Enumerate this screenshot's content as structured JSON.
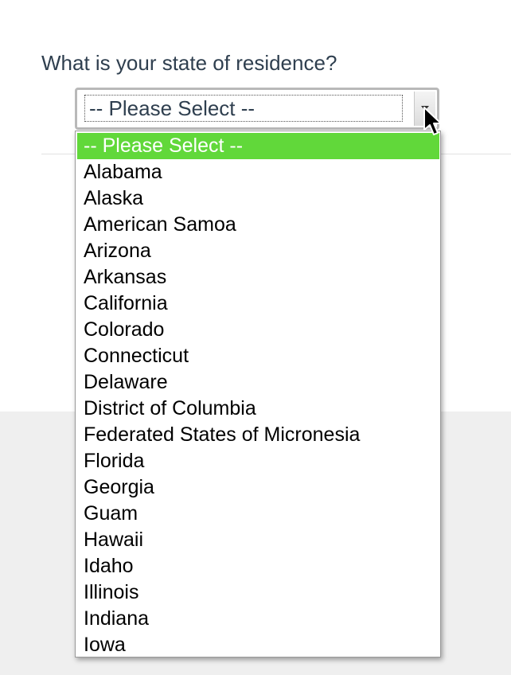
{
  "question": "What is your state of residence?",
  "select": {
    "value": "-- Please Select --"
  },
  "dropdown": {
    "options": [
      "-- Please Select --",
      "Alabama",
      "Alaska",
      "American Samoa",
      "Arizona",
      "Arkansas",
      "California",
      "Colorado",
      "Connecticut",
      "Delaware",
      "District of Columbia",
      "Federated States of Micronesia",
      "Florida",
      "Georgia",
      "Guam",
      "Hawaii",
      "Idaho",
      "Illinois",
      "Indiana",
      "Iowa"
    ],
    "highlighted_index": 0,
    "highlight_color": "#61d83a"
  },
  "colors": {
    "question_text": "#2f3f4f",
    "bottom_band": "#efefef"
  },
  "icons": {
    "select_arrow": "chevron-down-icon",
    "cursor": "mouse-pointer-icon"
  }
}
